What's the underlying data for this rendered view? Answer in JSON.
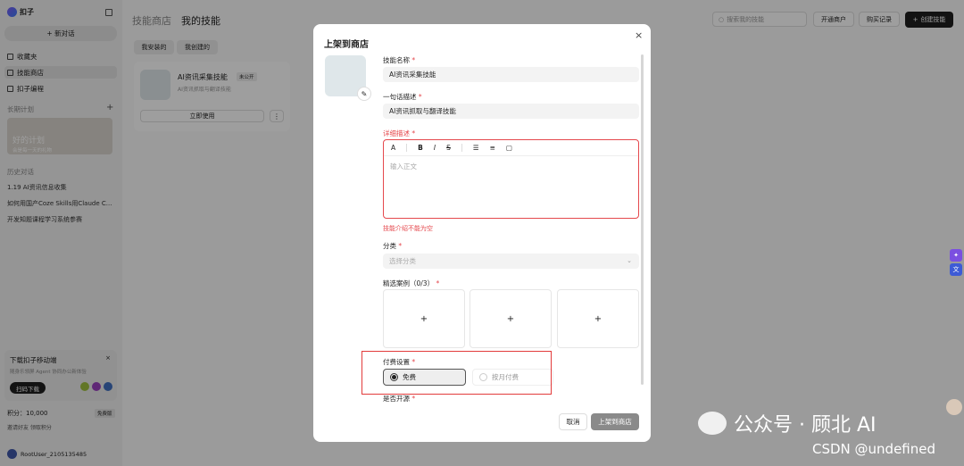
{
  "sidebar": {
    "brand": "扣子",
    "new_chat": "+ 新对话",
    "nav": [
      {
        "label": "收藏夹",
        "icon": "star-icon"
      },
      {
        "label": "技能商店",
        "icon": "store-icon"
      },
      {
        "label": "扣子编程",
        "icon": "code-icon"
      }
    ],
    "long_plan_label": "长期计划",
    "plan_card": {
      "title": "好的计划",
      "subtitle": "会是每一天的礼物"
    },
    "history_label": "历史对话",
    "history": [
      "1.19 AI资讯信息收集",
      "如何用国产Coze Skills用Claude C...",
      "开发知题课程学习系统参赛"
    ],
    "download": {
      "title": "下载扣子移动端",
      "subtitle": "随身乐领屏 Agent 协同办公新体验",
      "button": "扫码下载",
      "close": "×"
    },
    "points_label": "积分：10,000",
    "free_badge": "免费版",
    "invite": "邀请好友 领取积分",
    "user": "RootUser_2105135485"
  },
  "main": {
    "tabs": [
      "技能商店",
      "我的技能"
    ],
    "filters": [
      "我安装的",
      "我创建的"
    ],
    "card": {
      "name": "AI资讯采集技能",
      "badge": "未公开",
      "desc": "AI资讯抓取与翻译技能",
      "use_button": "立即使用",
      "more": "⋮"
    },
    "search_placeholder": "搜索我的技能",
    "header_buttons": [
      "开通商户",
      "购买记录"
    ],
    "create_button": "创建技能"
  },
  "modal": {
    "title": "上架到商店",
    "close": "×",
    "skill_name_label": "技能名称",
    "skill_name_value": "AI资讯采集技能",
    "one_line_label": "一句话描述",
    "one_line_value": "AI资讯抓取与翻译技能",
    "detail_label": "详细描述",
    "detail_placeholder": "输入正文",
    "detail_error": "技能介绍不能为空",
    "toolbar": [
      "A",
      "B",
      "I",
      "S"
    ],
    "category_label": "分类",
    "category_placeholder": "选择分类",
    "cases_label": "精选案例（0/3）",
    "plus": "+",
    "pay_label": "付费设置",
    "pay_options": [
      "免费",
      "按月付费"
    ],
    "open_source_label": "是否开源",
    "cancel": "取消",
    "submit": "上架到商店",
    "required_mark": "*"
  },
  "watermark": {
    "wechat": "公众号 · 顾北 AI",
    "csdn": "CSDN @undefined"
  },
  "colors": {
    "accent": "#1f1f1f",
    "error": "#e5484d",
    "highlight": "#e23b3b",
    "overlay": "rgba(0,0,0,0.38)"
  }
}
